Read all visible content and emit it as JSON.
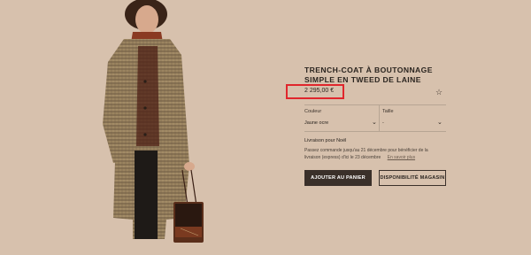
{
  "product": {
    "title_line1": "TRENCH-COAT À BOUTONNAGE",
    "title_line2": "SIMPLE EN TWEED DE LAINE",
    "price": "2 295,00 €"
  },
  "options": {
    "color_label": "Couleur",
    "color_value": "Jaune ocre",
    "size_label": "Taille",
    "size_value": "-"
  },
  "shipping": {
    "title": "Livraison pour Noël",
    "line1": "Passez commande jusqu'au 21 décembre pour bénéficier de la",
    "line2": "livraison (express) d'ici le 23 décembre",
    "link": "En savoir plus"
  },
  "actions": {
    "add_to_cart": "AJOUTER AU PANIER",
    "store_availability": "DISPONIBILITÉ MAGASIN"
  },
  "icons": {
    "favorite": "star-outline-icon",
    "chevron": "chevron-down-icon"
  },
  "colors": {
    "background": "#d7c1ad",
    "primary_button": "#3a302a",
    "highlight": "#e0262c"
  }
}
